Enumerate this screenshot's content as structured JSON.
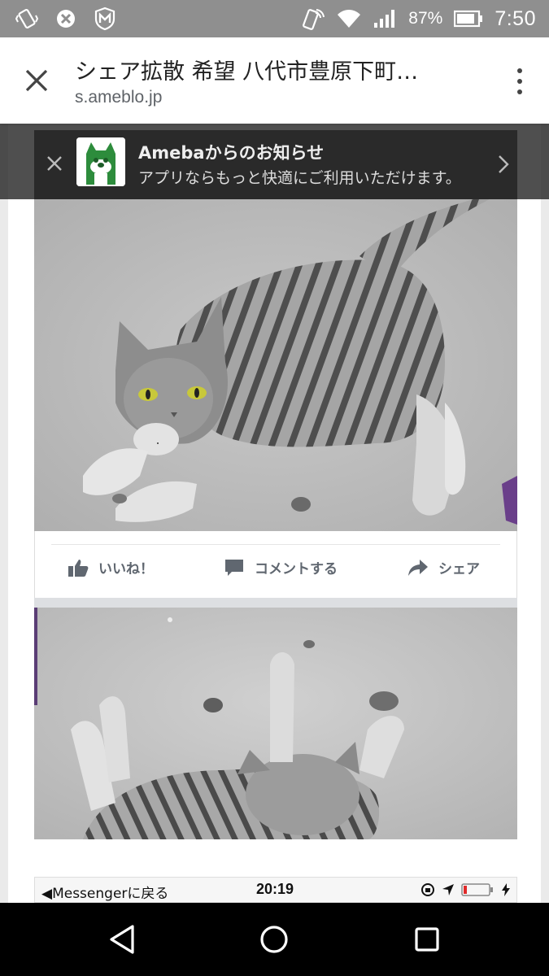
{
  "status_bar": {
    "battery_percent": "87%",
    "time": "7:50"
  },
  "toolbar": {
    "title": "シェア拡散 希望 八代市豊原下町…",
    "url": "s.ameblo.jp"
  },
  "banner": {
    "title": "Amebaからのお知らせ",
    "subtitle": "アプリならもっと快適にご利用いただけます。"
  },
  "facebook_actions": {
    "like": "いいね！",
    "comment": "コメントする",
    "share": "シェア"
  },
  "messenger_bar": {
    "back_label": "◀Messengerに戻る",
    "time": "20:19"
  },
  "colors": {
    "status_bar": "#8f8f8f",
    "ameba_green": "#2d8c3c",
    "fb_gray": "#606770"
  }
}
